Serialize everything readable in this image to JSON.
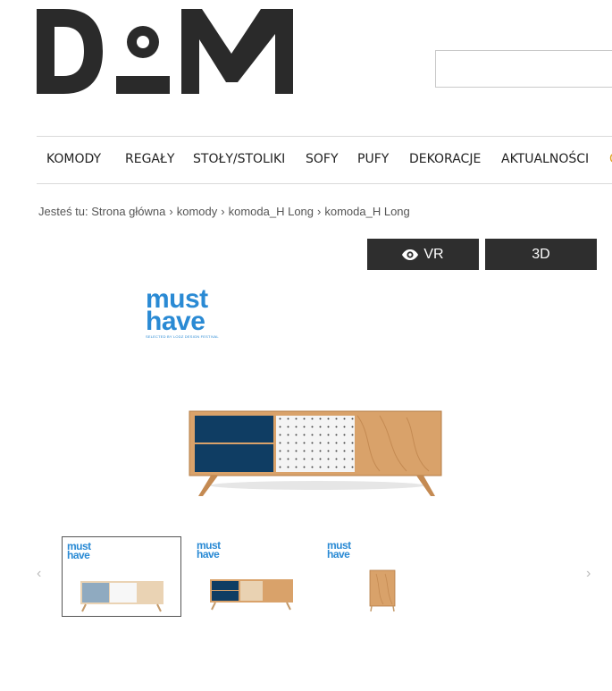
{
  "header": {
    "logo_text": "DOM",
    "search": {
      "value": "",
      "placeholder": ""
    }
  },
  "nav": {
    "items": [
      "KOMODY",
      "REGAŁY",
      "STOŁY/STOLIKI",
      "SOFY",
      "PUFY",
      "DEKORACJE",
      "AKTUALNOŚCI"
    ],
    "overflow_item": "O"
  },
  "breadcrumb": {
    "prefix": "Jesteś tu:",
    "items": [
      "Strona główna",
      "komody",
      "komoda_H Long",
      "komoda_H Long"
    ],
    "separator": "›"
  },
  "buttons": {
    "vr": "VR",
    "3d": "3D"
  },
  "badge": {
    "line1": "must",
    "line2": "have",
    "tagline": "SELECTED BY LODZ DESIGN FESTIVAL"
  },
  "product": {
    "colors": {
      "wood": "#d9a26a",
      "navy": "#0f3d63",
      "white": "#f4f4f4",
      "grey_blue": "#8faac0"
    }
  },
  "gallery": {
    "prev_icon": "‹",
    "next_icon": "›",
    "thumbnails": [
      {
        "name": "thumbnail-1",
        "selected": true
      },
      {
        "name": "thumbnail-2",
        "selected": false
      },
      {
        "name": "thumbnail-3",
        "selected": false
      }
    ]
  }
}
